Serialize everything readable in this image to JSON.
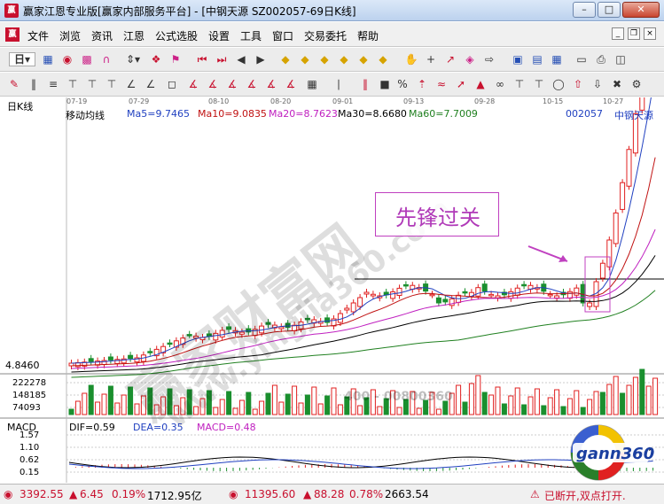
{
  "window": {
    "title": "赢家江恩专业版[赢家内部服务平台] - [中钢天源  SZ002057-69日K线]",
    "app_icon_text": "赢"
  },
  "menu": {
    "logo_text": "赢",
    "items": [
      "文件",
      "浏览",
      "资讯",
      "江恩",
      "公式选股",
      "设置",
      "工具",
      "窗口",
      "交易委托",
      "帮助"
    ]
  },
  "chart": {
    "panel_title": "日K线",
    "indicator_name": "移动均线",
    "ma": [
      {
        "label": "Ma5=9.7465",
        "color": "#2040c0"
      },
      {
        "label": "Ma10=9.0835",
        "color": "#c01010"
      },
      {
        "label": "Ma20=8.7623",
        "color": "#c020c0"
      },
      {
        "label": "Ma30=8.6680",
        "color": "#000000"
      },
      {
        "label": "Ma60=7.7009",
        "color": "#208020"
      }
    ],
    "stock_code": "002057",
    "stock_name": "中钢天源",
    "date_ticks": [
      "07-19",
      "07-29",
      "08-10",
      "08-20",
      "09-01",
      "09-13",
      "09-28",
      "10-15",
      "10-27"
    ],
    "price_label": "4.8460",
    "volume_ticks": [
      "222278",
      "148185",
      "74093"
    ],
    "phone_watermark": "400 - 00800360",
    "annotation": "先锋过关",
    "watermark_main": "赢家财富网",
    "watermark_url": "www.yingjia360.com"
  },
  "macd": {
    "title": "MACD",
    "dif": "DIF=0.59",
    "dea": "DEA=0.35",
    "macd": "MACD=0.48",
    "ticks": [
      "1.57",
      "1.10",
      "0.62",
      "0.15"
    ]
  },
  "logo": {
    "text": "gann360"
  },
  "status": {
    "sh_index": "3392.55",
    "sh_change": "6.45",
    "sh_pct": "0.19%",
    "sh_amount": "1712.95亿",
    "sz_index": "11395.60",
    "sz_change": "88.28",
    "sz_pct": "0.78%",
    "sz_amount": "2663.54",
    "connection": "已断开,双点打开."
  },
  "colors": {
    "up": "#e02020",
    "down": "#1a8f2e",
    "accent": "#c040c0"
  }
}
